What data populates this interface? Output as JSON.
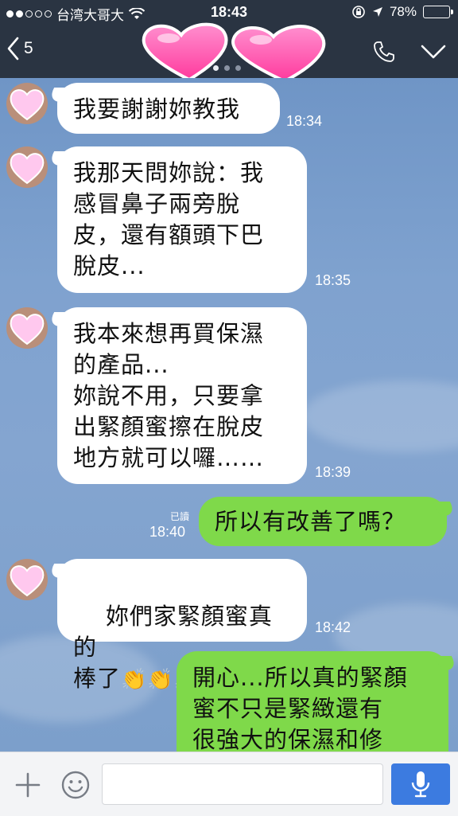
{
  "status_bar": {
    "carrier": "台湾大哥大",
    "time": "18:43",
    "battery": "78%",
    "battery_level": 0.78
  },
  "header": {
    "back_count": "5"
  },
  "messages": [
    {
      "side": "in",
      "text": "我要謝謝妳教我",
      "time": "18:34"
    },
    {
      "side": "in",
      "text": "我那天問妳說：我\n感冒鼻子兩旁脫\n皮，還有額頭下巴\n脫皮...",
      "time": "18:35"
    },
    {
      "side": "in",
      "text": "我本來想再買保濕\n的產品...\n妳說不用，只要拿\n出緊顏蜜擦在脫皮\n地方就可以囉……",
      "time": "18:39"
    },
    {
      "side": "out",
      "text": "所以有改善了嗎？",
      "time": "18:40",
      "read_label": "已讀"
    },
    {
      "side": "in",
      "text": "妳們家緊顏蜜真的\n棒了",
      "time": "18:42",
      "emoji": [
        "👏",
        "👏",
        "👏"
      ]
    },
    {
      "side": "out",
      "text": "開心...所以真的緊顏\n蜜不只是緊緻還有\n很強大的保濕和修",
      "time": ""
    }
  ],
  "colors": {
    "header": "#2a3442",
    "bubble_in": "#ffffff",
    "bubble_out": "#7fd94a",
    "mic_button": "#3c7be0"
  },
  "icons": [
    "back-chevron-icon",
    "phone-icon",
    "chevron-down-icon",
    "plus-icon",
    "emoji-icon",
    "mic-icon",
    "wifi-icon",
    "location-arrow-icon",
    "rotation-lock-icon"
  ]
}
